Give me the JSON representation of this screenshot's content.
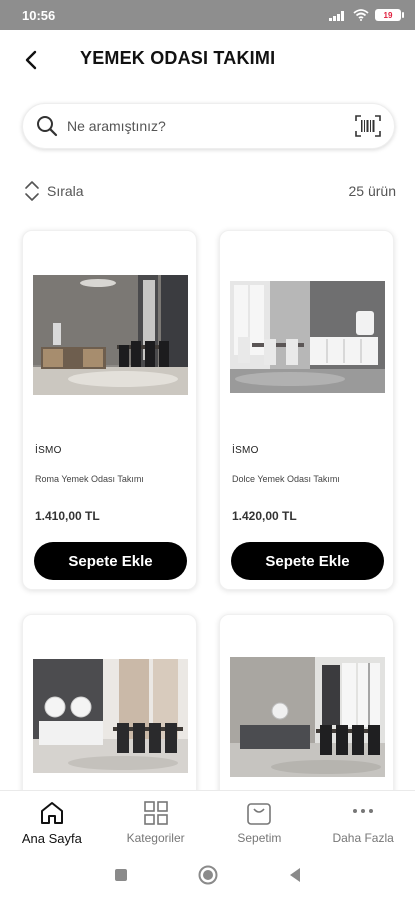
{
  "status_bar": {
    "time": "10:56",
    "battery": "19"
  },
  "header": {
    "title": "YEMEK ODASI TAKIMI"
  },
  "search": {
    "placeholder": "Ne aramıştınız?"
  },
  "sort": {
    "label": "Sırala",
    "count": "25 ürün"
  },
  "products": [
    {
      "brand": "İSMO",
      "name": "Roma Yemek Odası Takımı",
      "price": "1.410,00 TL",
      "button": "Sepete Ekle"
    },
    {
      "brand": "İSMO",
      "name": "Dolce Yemek Odası Takımı",
      "price": "1.420,00 TL",
      "button": "Sepete Ekle"
    },
    {
      "brand": "",
      "name": "",
      "price": "",
      "button": ""
    },
    {
      "brand": "",
      "name": "",
      "price": "",
      "button": ""
    }
  ],
  "bottom_nav": {
    "items": [
      {
        "label": "Ana Sayfa",
        "icon": "home-icon",
        "active": true
      },
      {
        "label": "Kategoriler",
        "icon": "grid-icon",
        "active": false
      },
      {
        "label": "Sepetim",
        "icon": "cart-icon",
        "active": false
      },
      {
        "label": "Daha Fazla",
        "icon": "more-icon",
        "active": false
      }
    ]
  }
}
